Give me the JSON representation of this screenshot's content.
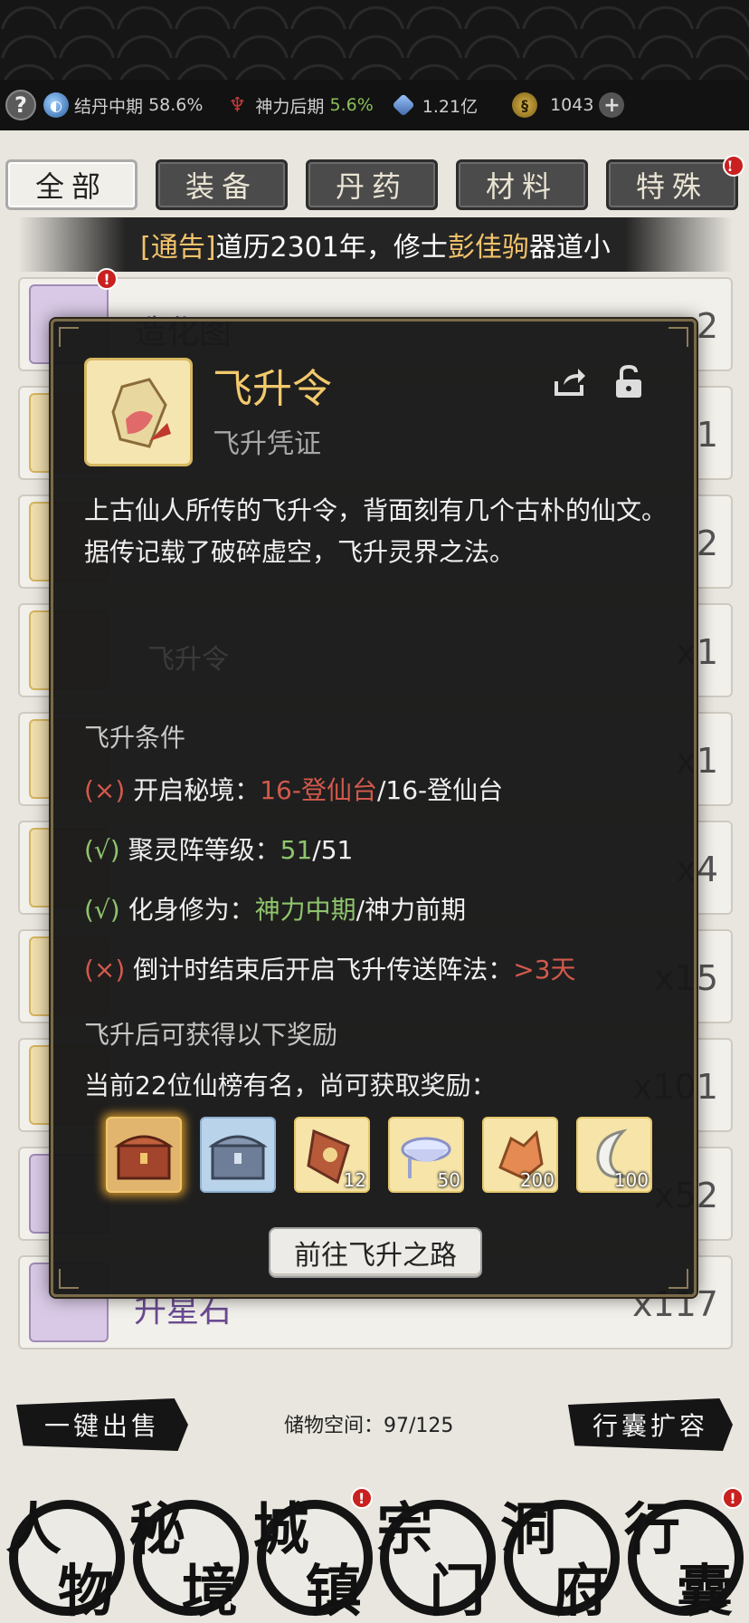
{
  "status": {
    "help_icon": "question-icon",
    "realm_label": "结丹中期",
    "realm_value": "58.6%",
    "power_label": "神力后期",
    "power_value": "5.6%",
    "gem_value": "1.21亿",
    "coin_value": "1043"
  },
  "tabs": [
    {
      "label": "全部",
      "active": true
    },
    {
      "label": "装备"
    },
    {
      "label": "丹药"
    },
    {
      "label": "材料"
    },
    {
      "label": "特殊",
      "badge": "!"
    }
  ],
  "notice": {
    "tag": "[通告]",
    "text_a": "道历2301年，修士",
    "name": "彭佳驹",
    "text_b": "器道小"
  },
  "list": [
    {
      "name": "造化图",
      "count": "2"
    },
    {
      "name": "",
      "count": "1"
    },
    {
      "name": "",
      "count": "2"
    },
    {
      "name": "飞升令",
      "count": "x1"
    },
    {
      "name": "",
      "count": "x1"
    },
    {
      "name": "",
      "count": "x4"
    },
    {
      "name": "",
      "count": "x15"
    },
    {
      "name": "",
      "count": "x101"
    },
    {
      "name": "",
      "count": "x52"
    },
    {
      "name": "升星石",
      "count": "x117"
    }
  ],
  "modal": {
    "title": "飞升令",
    "subtitle": "飞升凭证",
    "description": "上古仙人所传的飞升令，背面刻有几个古朴的仙文。据传记载了破碎虚空，飞升灵界之法。",
    "ghost_text": "飞升令",
    "conditions_title": "飞升条件",
    "conditions": [
      {
        "mark": "(×)",
        "ok": false,
        "label": "开启秘境：",
        "value": "16-登仙台",
        "target": "/16-登仙台"
      },
      {
        "mark": "(√)",
        "ok": true,
        "label": "聚灵阵等级：",
        "value": "51",
        "target": "/51"
      },
      {
        "mark": "(√)",
        "ok": true,
        "label": "化身修为：",
        "value": "神力中期",
        "target": "/神力前期"
      },
      {
        "mark": "(×)",
        "ok": false,
        "label": "倒计时结束后开启飞升传送阵法：",
        "value": ">3天",
        "target": ""
      }
    ],
    "rewards_title": "飞升后可获得以下奖励",
    "rewards_note": "当前22位仙榜有名，尚可获取奖励：",
    "rewards": [
      {
        "icon": "gold-chest-icon",
        "qty": ""
      },
      {
        "icon": "silver-chest-icon",
        "qty": ""
      },
      {
        "icon": "talisman-icon",
        "qty": "12"
      },
      {
        "icon": "crystal-bowl-icon",
        "qty": "50"
      },
      {
        "icon": "ore-icon",
        "qty": "200"
      },
      {
        "icon": "crescent-jade-icon",
        "qty": "100"
      }
    ],
    "cta_label": "前往飞升之路"
  },
  "bottom": {
    "sell_label": "一键出售",
    "storage_label": "储物空间：97/125",
    "expand_label": "行囊扩容"
  },
  "nav": [
    {
      "c1": "人",
      "c2": "物",
      "badge": false
    },
    {
      "c1": "秘",
      "c2": "境",
      "badge": false
    },
    {
      "c1": "城",
      "c2": "镇",
      "badge": true
    },
    {
      "c1": "宗",
      "c2": "门",
      "badge": false
    },
    {
      "c1": "洞",
      "c2": "府",
      "badge": false
    },
    {
      "c1": "行",
      "c2": "囊",
      "badge": true
    }
  ]
}
